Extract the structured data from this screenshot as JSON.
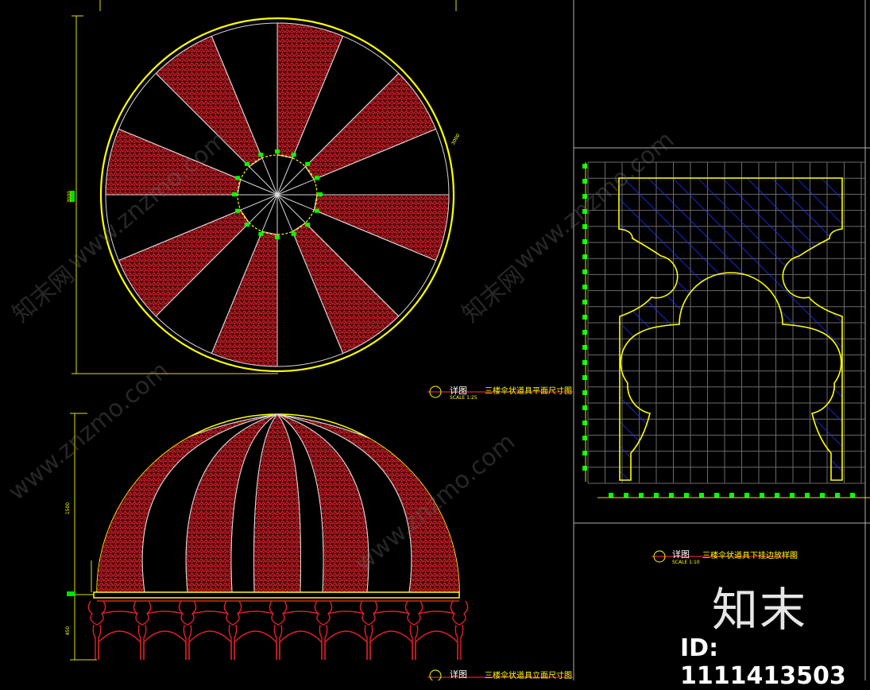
{
  "drawings": {
    "plan": {
      "symbol": "详图",
      "title": "三楼伞状道具平面尺寸图",
      "scale": "SCALE 1:25"
    },
    "elevation": {
      "symbol": "详图",
      "title": "三楼伞状道具立面尺寸图"
    },
    "detail": {
      "symbol": "详图",
      "title": "三楼伞状道具下挂边放样图",
      "scale": "SCALE 1:10"
    }
  },
  "dimensions": {
    "plan_diameter": "3000",
    "plan_side": "3000",
    "elev_height": "1500",
    "elev_base": "450"
  },
  "watermarks": {
    "site_cn": "知末网",
    "site_en": "www.znzmo.com"
  },
  "branding": {
    "logo": "知末",
    "id_text": "ID: 1111413503"
  },
  "colors": {
    "background": "#000000",
    "outline": "#ffff00",
    "hatch": "#c0121b",
    "line": "#d8d8d8",
    "dim": "#00ff00",
    "blue_hatch": "#2030ff",
    "grid": "#6a6a6a",
    "border": "#b0b0b0"
  }
}
